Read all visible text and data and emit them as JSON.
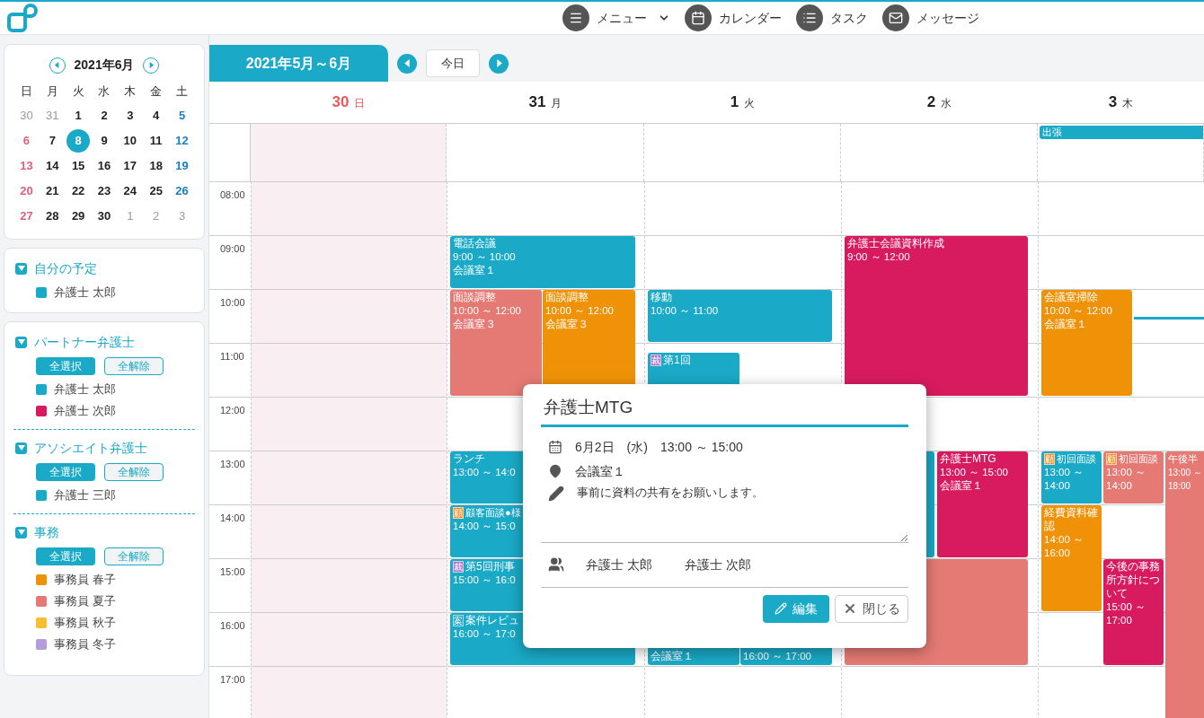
{
  "nav": [
    {
      "label": "メニュー",
      "kind": "menu",
      "dropdown": true
    },
    {
      "label": "カレンダー",
      "kind": "calendar",
      "dropdown": false
    },
    {
      "label": "タスク",
      "kind": "list",
      "dropdown": false
    },
    {
      "label": "メッセージ",
      "kind": "mail",
      "dropdown": false
    }
  ],
  "mini_calendar": {
    "title": "2021年6月",
    "weekdays": [
      "日",
      "月",
      "火",
      "水",
      "木",
      "金",
      "土"
    ],
    "weeks": [
      [
        {
          "d": "30",
          "muted": true,
          "selected": false
        },
        {
          "d": "31",
          "muted": true,
          "selected": false
        },
        {
          "d": "1",
          "muted": false,
          "selected": false
        },
        {
          "d": "2",
          "muted": false,
          "selected": false
        },
        {
          "d": "3",
          "muted": false,
          "selected": false
        },
        {
          "d": "4",
          "muted": false,
          "selected": false
        },
        {
          "d": "5",
          "muted": false,
          "selected": false
        }
      ],
      [
        {
          "d": "6",
          "muted": false,
          "selected": false
        },
        {
          "d": "7",
          "muted": false,
          "selected": false
        },
        {
          "d": "8",
          "muted": false,
          "selected": true
        },
        {
          "d": "9",
          "muted": false,
          "selected": false
        },
        {
          "d": "10",
          "muted": false,
          "selected": false
        },
        {
          "d": "11",
          "muted": false,
          "selected": false
        },
        {
          "d": "12",
          "muted": false,
          "selected": false
        }
      ],
      [
        {
          "d": "13",
          "muted": false,
          "selected": false
        },
        {
          "d": "14",
          "muted": false,
          "selected": false
        },
        {
          "d": "15",
          "muted": false,
          "selected": false
        },
        {
          "d": "16",
          "muted": false,
          "selected": false
        },
        {
          "d": "17",
          "muted": false,
          "selected": false
        },
        {
          "d": "18",
          "muted": false,
          "selected": false
        },
        {
          "d": "19",
          "muted": false,
          "selected": false
        }
      ],
      [
        {
          "d": "20",
          "muted": false,
          "selected": false
        },
        {
          "d": "21",
          "muted": false,
          "selected": false
        },
        {
          "d": "22",
          "muted": false,
          "selected": false
        },
        {
          "d": "23",
          "muted": false,
          "selected": false
        },
        {
          "d": "24",
          "muted": false,
          "selected": false
        },
        {
          "d": "25",
          "muted": false,
          "selected": false
        },
        {
          "d": "26",
          "muted": false,
          "selected": false
        }
      ],
      [
        {
          "d": "27",
          "muted": false,
          "selected": false
        },
        {
          "d": "28",
          "muted": false,
          "selected": false
        },
        {
          "d": "29",
          "muted": false,
          "selected": false
        },
        {
          "d": "30",
          "muted": false,
          "selected": false
        },
        {
          "d": "1",
          "muted": true,
          "selected": false
        },
        {
          "d": "2",
          "muted": true,
          "selected": false
        },
        {
          "d": "3",
          "muted": true,
          "selected": false
        }
      ]
    ]
  },
  "groups": [
    {
      "title": "自分の予定",
      "expanded": true,
      "members": [
        {
          "name": "弁護士 太郎",
          "color": "#1aa9c6"
        }
      ]
    },
    {
      "title": "パートナー弁護士",
      "expanded": true,
      "buttons": [
        "全選択",
        "全解除"
      ],
      "members": [
        {
          "name": "弁護士 太郎",
          "color": "#1aa9c6"
        },
        {
          "name": "弁護士 次郎",
          "color": "#d81b5f"
        }
      ]
    },
    {
      "title": "アソシエイト弁護士",
      "expanded": true,
      "buttons": [
        "全選択",
        "全解除"
      ],
      "members": [
        {
          "name": "弁護士 三郎",
          "color": "#1aa9c6"
        }
      ]
    },
    {
      "title": "事務",
      "expanded": true,
      "buttons": [
        "全選択",
        "全解除"
      ],
      "members": [
        {
          "name": "事務員 春子",
          "color": "#ef9208"
        },
        {
          "name": "事務員 夏子",
          "color": "#e57a74"
        },
        {
          "name": "事務員 秋子",
          "color": "#f5c02f"
        },
        {
          "name": "事務員 冬子",
          "color": "#b39ddb"
        }
      ]
    }
  ],
  "range_title": "2021年5月～6月",
  "today_button": "今日",
  "times": [
    "08:00",
    "09:00",
    "10:00",
    "11:00",
    "12:00",
    "13:00",
    "14:00",
    "15:00",
    "16:00",
    "17:00"
  ],
  "days": [
    {
      "num": "30",
      "dow": "日",
      "kind": "sunday"
    },
    {
      "num": "31",
      "dow": "月",
      "kind": "weekday",
      "events": [
        {
          "title": "電話会議",
          "color": "#1aa9c6",
          "lines": [
            "9:00 ～ 10:00",
            "会議室１"
          ]
        },
        {
          "title": "面談調整",
          "color": "#e57a74",
          "lines": [
            "10:00 ～ 12:00",
            "会議室３"
          ]
        },
        {
          "title": "面談調整",
          "color": "#ef9208",
          "lines": [
            "10:00 ～ 12:00",
            "会議室３"
          ]
        },
        {
          "title": "ランチ",
          "color": "#1aa9c6",
          "lines": [
            "13:00 ～ 14:0"
          ]
        },
        {
          "title": "顧客面談●様",
          "badge": {
            "text": "顧",
            "color": "#f0902c"
          },
          "color": "#1aa9c6",
          "lines": [
            "14:00 ～ 15:0"
          ]
        },
        {
          "title": "第5回刑事",
          "badge": {
            "text": "裁",
            "color": "#a879c9"
          },
          "color": "#1aa9c6",
          "lines": [
            "15:00 ～ 16:0"
          ]
        },
        {
          "title": "案件レビュ",
          "badge": {
            "text": "案",
            "color": "#1aa9c6"
          },
          "color": "#1aa9c6",
          "lines": [
            "16:00 ～ 17:0"
          ]
        }
      ]
    },
    {
      "num": "1",
      "dow": "火",
      "kind": "weekday",
      "events": [
        {
          "title": "移動",
          "color": "#1aa9c6",
          "lines": [
            "10:00 ～ 11:00"
          ]
        },
        {
          "title": "第1回",
          "badge": {
            "text": "裁",
            "color": "#a879c9"
          },
          "color": "#1aa9c6"
        },
        {
          "color": "#1aa9c6",
          "lines": [
            "会議室１"
          ]
        },
        {
          "color": "#1aa9c6",
          "lines": [
            "16:00 ～ 17:00"
          ]
        }
      ]
    },
    {
      "num": "2",
      "dow": "水",
      "kind": "weekday",
      "events": [
        {
          "title": "弁護士会議資料作成",
          "color": "#d81b5f",
          "lines": [
            "9:00 ～ 12:00"
          ]
        },
        {
          "color": "#1aa9c6"
        },
        {
          "title": "弁護士MTG",
          "color": "#d81b5f",
          "lines": [
            "13:00 ～ 15:00",
            "会議室１"
          ]
        },
        {
          "color": "#e57a74"
        }
      ]
    },
    {
      "num": "3",
      "dow": "木",
      "kind": "weekday",
      "all_day": [
        {
          "title": "出張",
          "color": "#1aa9c6"
        }
      ],
      "events": [
        {
          "title": "会議室掃除",
          "color": "#ef9208",
          "lines": [
            "10:00 ～ 12:00",
            "会議室１"
          ]
        },
        {
          "title": "初回面談",
          "badge": {
            "text": "顧",
            "color": "#f0902c"
          },
          "color": "#1aa9c6",
          "lines": [
            "13:00 ～",
            "14:00"
          ]
        },
        {
          "title": "初回面談",
          "badge": {
            "text": "顧",
            "color": "#f0902c"
          },
          "color": "#e57a74",
          "lines": [
            "13:00 ～",
            "14:00"
          ]
        },
        {
          "title": "経費資料確認",
          "color": "#ef9208",
          "lines": [
            "14:00 ～",
            "16:00"
          ]
        },
        {
          "title": "今後の事務所方針について",
          "color": "#d81b5f",
          "lines": [
            "15:00 ～",
            "17:00"
          ]
        },
        {
          "title": "午後半",
          "color": "#e57a74",
          "lines": [
            "13:00 ～",
            "18:00"
          ]
        }
      ]
    }
  ],
  "popup": {
    "title": "弁護士MTG",
    "date": "6月2日　(水)　13:00 ～ 15:00",
    "location": "会議室１",
    "note": "事前に資料の共有をお願いします。",
    "attendees": [
      "弁護士 太郎",
      "弁護士 次郎"
    ],
    "buttons": [
      {
        "label": "編集",
        "kind": "edit"
      },
      {
        "label": "閉じる",
        "kind": "close"
      }
    ]
  }
}
